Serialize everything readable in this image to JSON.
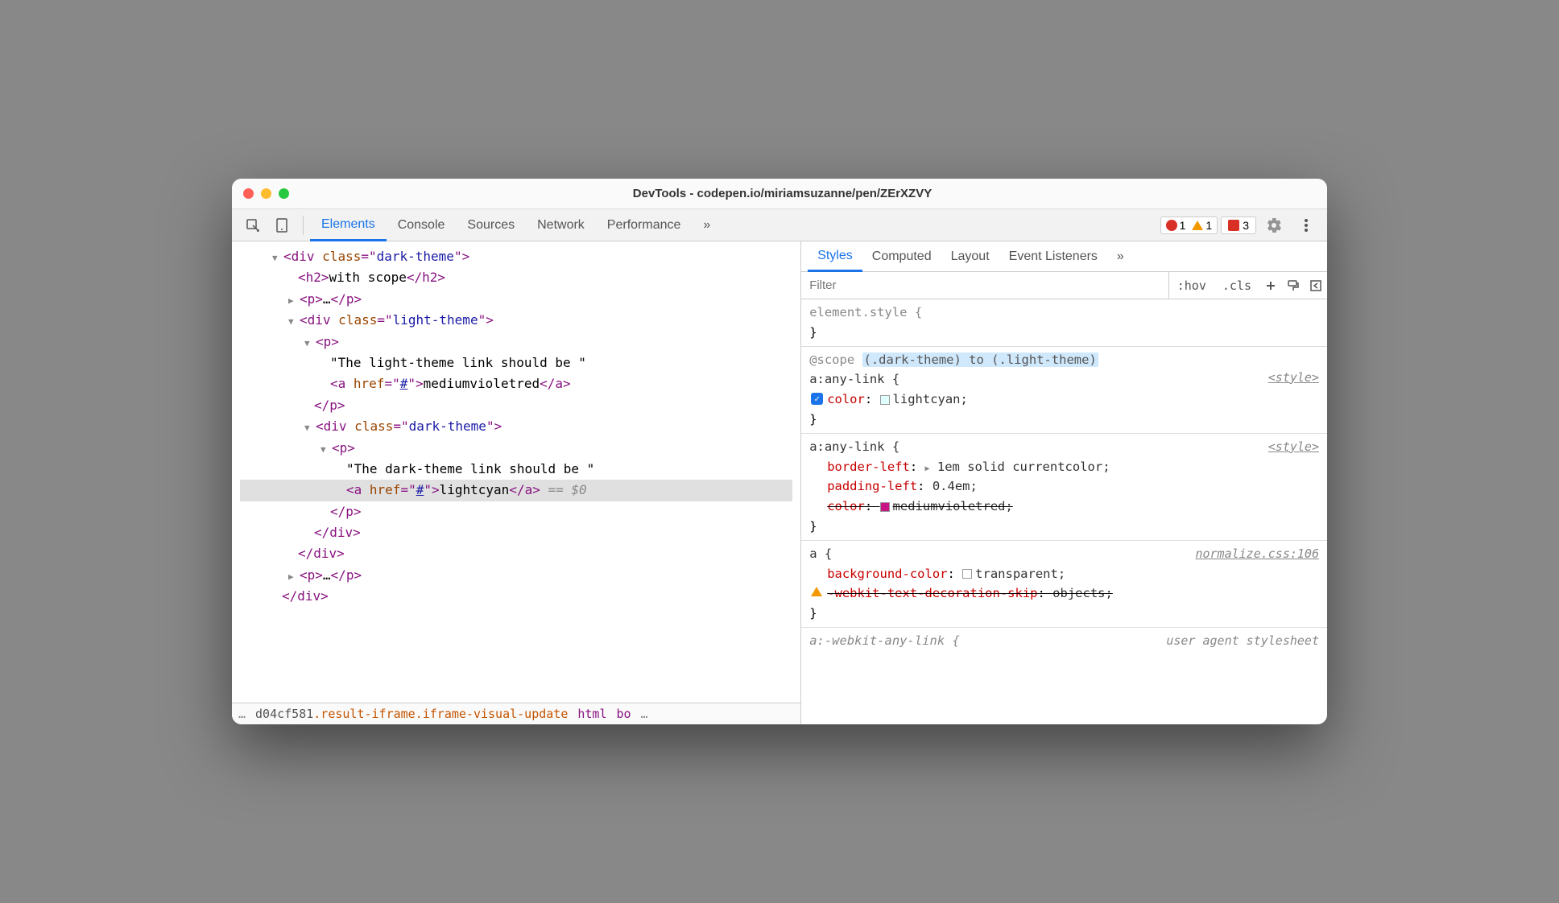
{
  "window": {
    "title": "DevTools - codepen.io/miriamsuzanne/pen/ZErXZVY"
  },
  "tabs": {
    "elements": "Elements",
    "console": "Console",
    "sources": "Sources",
    "network": "Network",
    "performance": "Performance",
    "more": "»"
  },
  "badges": {
    "errors": "1",
    "warnings": "1",
    "issues": "3"
  },
  "dom": {
    "div_dark_open": "<div class=\"dark-theme\">",
    "h2_open": "<h2>",
    "h2_text": "with scope",
    "h2_close": "</h2>",
    "p_collapsed_open": "<p>",
    "p_collapsed_text": "…",
    "p_collapsed_close": "</p>",
    "div_light_open": "<div class=\"light-theme\">",
    "p_open": "<p>",
    "text_light": "\"The light-theme link should be \"",
    "a_open": "<a href=\"#\">",
    "a_text_light": "mediumvioletred",
    "a_close": "</a>",
    "p_close": "</p>",
    "div_dark2_open": "<div class=\"dark-theme\">",
    "text_dark": "\"The dark-theme link should be \"",
    "a_text_dark": "lightcyan",
    "eq0": " == $0",
    "div_close": "</div>",
    "p2_collapsed_open": "<p>",
    "p2_collapsed_text": "…",
    "p2_collapsed_close": "</p>"
  },
  "breadcrumbs": {
    "ellipsis": "…",
    "item1": "d04cf581",
    "item2": ".result-iframe.iframe-visual-update",
    "item3": "html",
    "item4": "bo",
    "trail_ellipsis": "…"
  },
  "styles_tabs": {
    "styles": "Styles",
    "computed": "Computed",
    "layout": "Layout",
    "listeners": "Event Listeners",
    "more": "»"
  },
  "filter": {
    "placeholder": "Filter",
    "hov": ":hov",
    "cls": ".cls"
  },
  "rules": {
    "element_style": "element.style {",
    "brace_close": "}",
    "scope_prefix": "@scope ",
    "scope_highlight": "(.dark-theme) to (.light-theme)",
    "any_link": "a:any-link {",
    "style_source": "<style>",
    "color_prop": "color",
    "lightcyan": "lightcyan;",
    "border_left": "border-left",
    "border_left_val": "1em solid currentcolor;",
    "padding_left": "padding-left",
    "padding_left_val": "0.4em;",
    "mediumvioletred": "mediumvioletred;",
    "a_selector": "a {",
    "normalize_src": "normalize.css:106",
    "bg_color": "background-color",
    "transparent": "transparent;",
    "webkit_skip": "-webkit-text-decoration-skip",
    "objects": "objects;",
    "webkit_any": "a:-webkit-any-link {",
    "ua_sheet": "user agent stylesheet"
  }
}
